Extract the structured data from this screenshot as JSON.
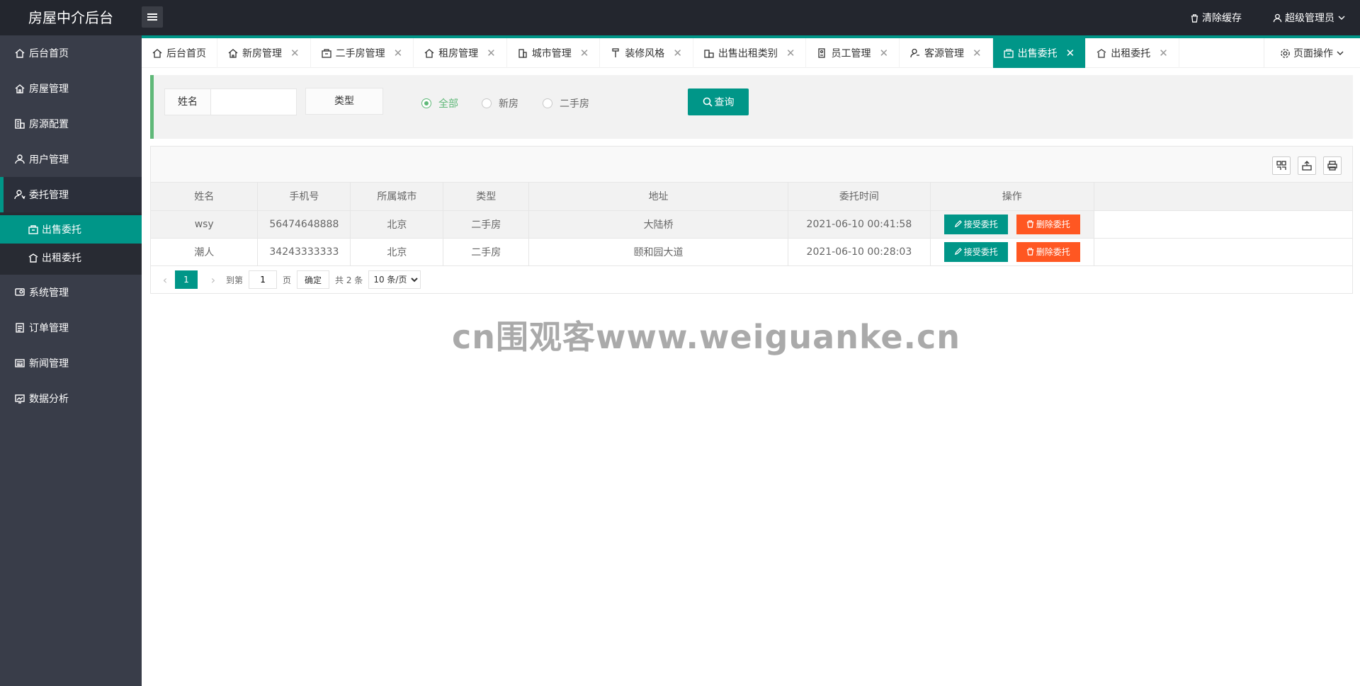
{
  "header": {
    "title": "房屋中介后台",
    "clear_cache": "清除缓存",
    "admin": "超级管理员"
  },
  "sidebar": {
    "items": [
      {
        "label": "后台首页",
        "icon": "home-icon"
      },
      {
        "label": "房屋管理",
        "icon": "house-icon"
      },
      {
        "label": "房源配置",
        "icon": "building-icon"
      },
      {
        "label": "用户管理",
        "icon": "user-icon"
      },
      {
        "label": "委托管理",
        "icon": "agent-icon"
      },
      {
        "label": "系统管理",
        "icon": "system-icon"
      },
      {
        "label": "订单管理",
        "icon": "order-icon"
      },
      {
        "label": "新闻管理",
        "icon": "news-icon"
      },
      {
        "label": "数据分析",
        "icon": "chart-icon"
      }
    ],
    "sub_items": [
      {
        "label": "出售委托",
        "icon": "sale-icon"
      },
      {
        "label": "出租委托",
        "icon": "rent-icon"
      }
    ]
  },
  "tabs": [
    {
      "label": "后台首页"
    },
    {
      "label": "新房管理"
    },
    {
      "label": "二手房管理"
    },
    {
      "label": "租房管理"
    },
    {
      "label": "城市管理"
    },
    {
      "label": "装修风格"
    },
    {
      "label": "出售出租类别"
    },
    {
      "label": "员工管理"
    },
    {
      "label": "客源管理"
    },
    {
      "label": "出售委托"
    },
    {
      "label": "出租委托"
    }
  ],
  "tab_close": "✕",
  "page_ops": "页面操作",
  "search": {
    "name_label": "姓名",
    "name_value": "",
    "type_label": "类型",
    "radios": [
      "全部",
      "新房",
      "二手房"
    ],
    "button": "查询"
  },
  "table": {
    "columns": [
      "姓名",
      "手机号",
      "所属城市",
      "类型",
      "地址",
      "委托时间",
      "操作"
    ],
    "rows": [
      [
        "wsy",
        "56474648888",
        "北京",
        "二手房",
        "大陆桥",
        "2021-06-10 00:41:58"
      ],
      [
        "潮人",
        "34243333333",
        "北京",
        "二手房",
        "颐和园大道",
        "2021-06-10 00:28:03"
      ]
    ],
    "accept_label": "接受委托",
    "delete_label": "删除委托"
  },
  "pager": {
    "current": "1",
    "goto": "到第",
    "page_value": "1",
    "page_unit": "页",
    "confirm": "确定",
    "total": "共 2 条",
    "per_page": "10 条/页"
  },
  "watermark": "cn围观客www.weiguanke.cn",
  "colors": {
    "accent": "#009688",
    "danger": "#ff5722",
    "header_bg": "#23262e",
    "sidebar_bg": "#393d49",
    "radio_green": "#5fb878"
  }
}
